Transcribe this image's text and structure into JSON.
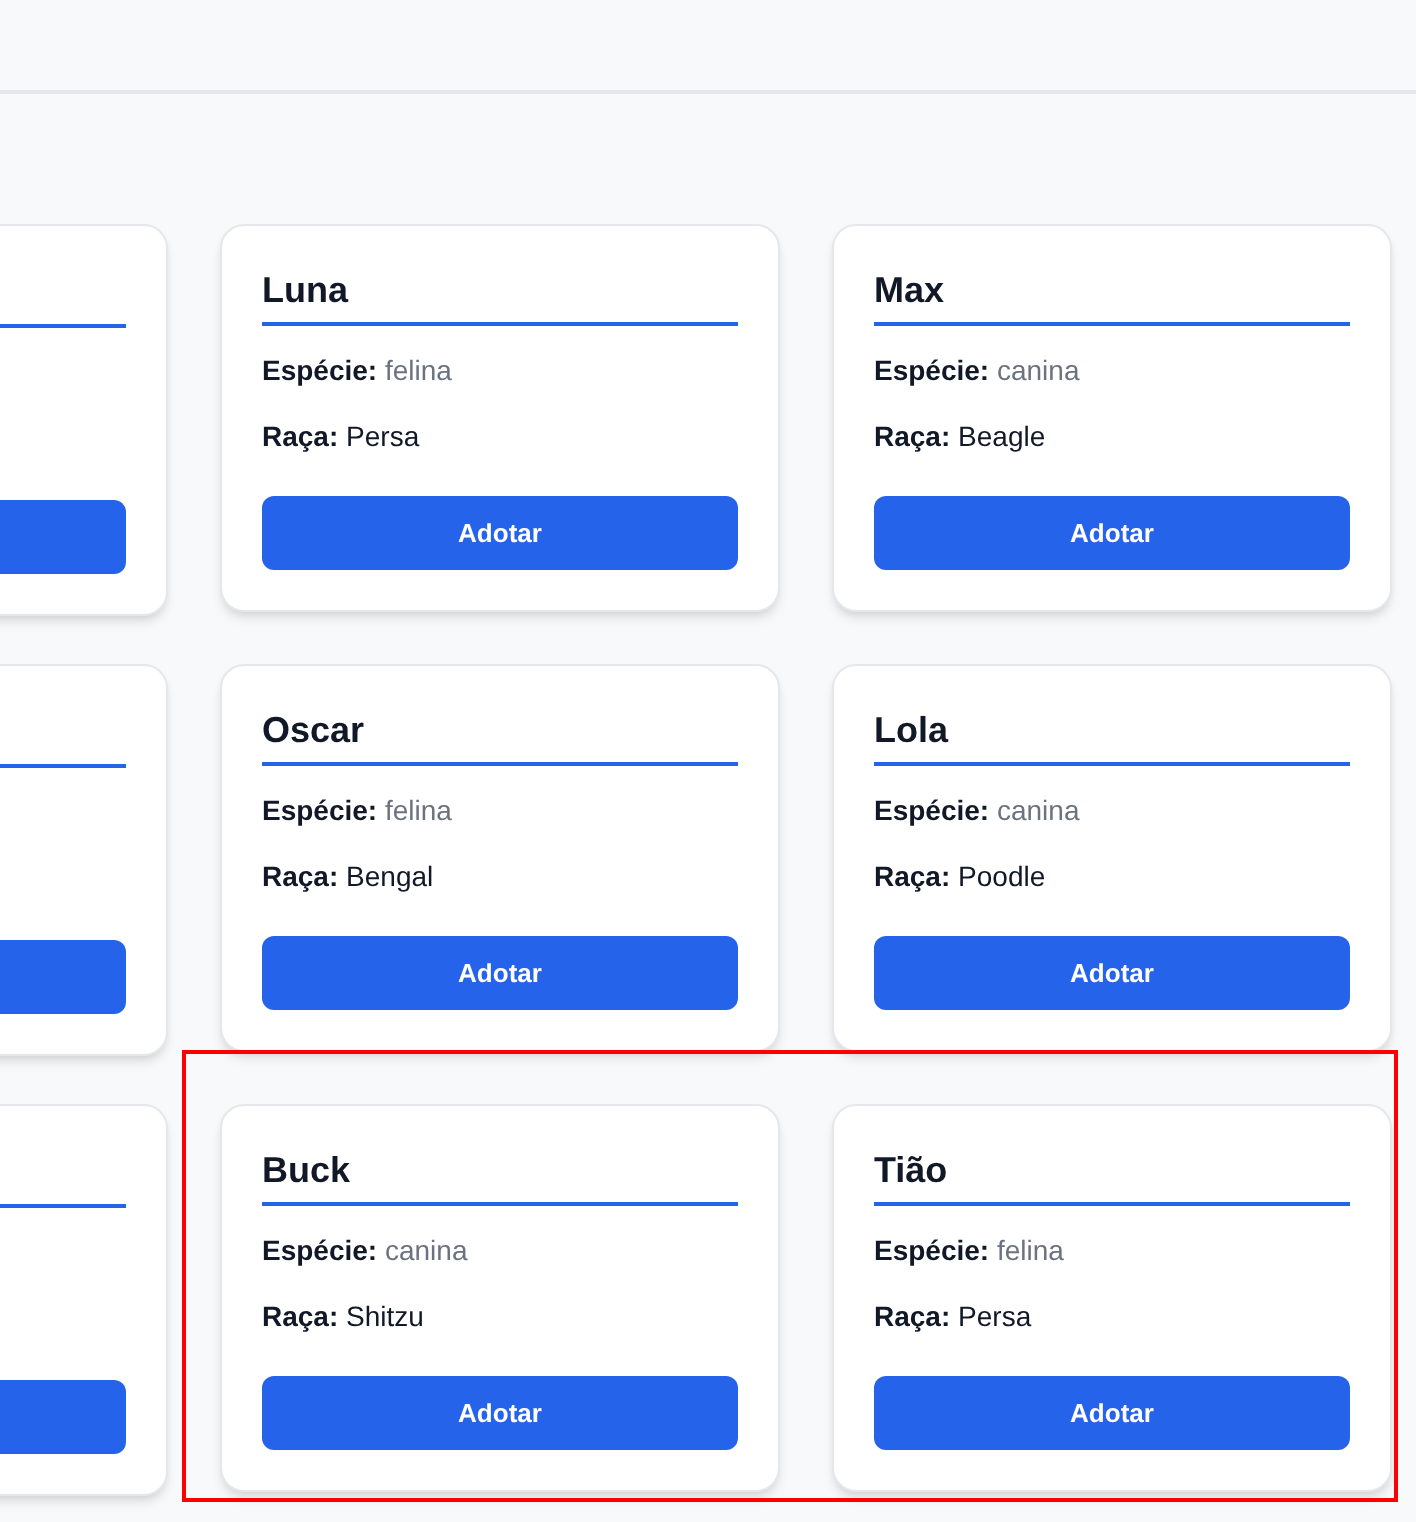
{
  "rows": [
    {
      "highlighted": false,
      "cards": [
        {
          "name": "Luna",
          "fields": [
            {
              "kind": "species",
              "label": "Espécie:",
              "value": "felina"
            },
            {
              "kind": "breed",
              "label": "Raça:",
              "value": "Persa"
            }
          ],
          "button": "Adotar"
        },
        {
          "name": "Max",
          "fields": [
            {
              "kind": "species",
              "label": "Espécie:",
              "value": "canina"
            },
            {
              "kind": "breed",
              "label": "Raça:",
              "value": "Beagle"
            }
          ],
          "button": "Adotar"
        }
      ]
    },
    {
      "highlighted": false,
      "cards": [
        {
          "name": "Oscar",
          "fields": [
            {
              "kind": "species",
              "label": "Espécie:",
              "value": "felina"
            },
            {
              "kind": "breed",
              "label": "Raça:",
              "value": "Bengal"
            }
          ],
          "button": "Adotar"
        },
        {
          "name": "Lola",
          "fields": [
            {
              "kind": "species",
              "label": "Espécie:",
              "value": "canina"
            },
            {
              "kind": "breed",
              "label": "Raça:",
              "value": "Poodle"
            }
          ],
          "button": "Adotar"
        }
      ]
    },
    {
      "highlighted": true,
      "cards": [
        {
          "name": "Buck",
          "fields": [
            {
              "kind": "species",
              "label": "Espécie:",
              "value": "canina"
            },
            {
              "kind": "breed",
              "label": "Raça:",
              "value": "Shitzu"
            }
          ],
          "button": "Adotar"
        },
        {
          "name": "Tião",
          "fields": [
            {
              "kind": "species",
              "label": "Espécie:",
              "value": "felina"
            },
            {
              "kind": "breed",
              "label": "Raça:",
              "value": "Persa"
            }
          ],
          "button": "Adotar"
        }
      ]
    }
  ]
}
